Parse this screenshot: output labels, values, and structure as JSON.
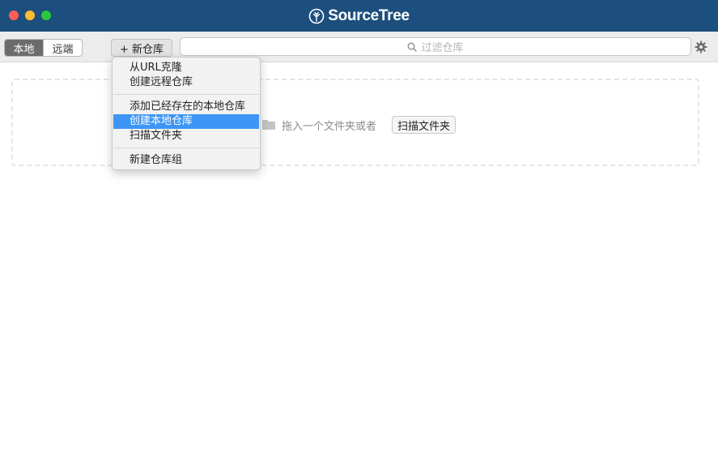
{
  "window": {
    "app_title": "SourceTree"
  },
  "toolbar": {
    "tabs": [
      {
        "label": "本地",
        "active": true
      },
      {
        "label": "远端",
        "active": false
      }
    ],
    "new_repo_label": "+ 新仓库",
    "filter_placeholder": "过滤仓库",
    "icons": [
      "search-icon",
      "gear-icon"
    ]
  },
  "dropzone": {
    "text": "拖入一个文件夹或者",
    "scan_button_label": "扫描文件夹",
    "icon": "folder-icon"
  },
  "menu": {
    "items": [
      {
        "label": "从URL克隆"
      },
      {
        "label": "创建远程仓库"
      },
      {
        "label": "添加已经存在的本地仓库"
      },
      {
        "label": "创建本地仓库",
        "highlighted": true
      },
      {
        "label": "扫描文件夹"
      },
      {
        "label": "新建仓库组"
      }
    ],
    "highlight_color": "#3d96f5"
  },
  "colors": {
    "titlebar": "#1c4f7e",
    "close": "#ff5f57",
    "minimize": "#febc2e",
    "maximize": "#28c840"
  }
}
